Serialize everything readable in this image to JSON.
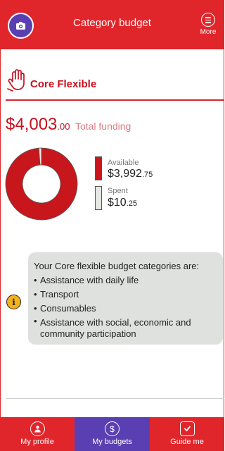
{
  "header": {
    "title": "Category budget",
    "more_label": "More"
  },
  "category": {
    "title": "Core Flexible"
  },
  "funding": {
    "total_major": "$4,003",
    "total_minor": ".00",
    "total_label": "Total funding"
  },
  "chart_data": {
    "type": "pie",
    "title": "",
    "categories": [
      "Available",
      "Spent"
    ],
    "values": [
      3992.75,
      10.25
    ],
    "colors": [
      "#c8161d",
      "#e6e8e6"
    ]
  },
  "legend": {
    "available_label": "Available",
    "available_major": "$3,992",
    "available_minor": ".75",
    "spent_label": "Spent",
    "spent_major": "$10",
    "spent_minor": ".25"
  },
  "info": {
    "intro": "Your Core flexible budget categories are:",
    "items": [
      "Assistance with daily life",
      "Transport",
      "Consumables",
      "Assistance with social, economic and community participation"
    ]
  },
  "nav": {
    "items": [
      {
        "label": "My profile",
        "icon": "person-icon"
      },
      {
        "label": "My budgets",
        "icon": "dollar-icon"
      },
      {
        "label": "Guide me",
        "icon": "checklist-icon"
      }
    ]
  },
  "colors": {
    "brand_red": "#e0262b",
    "brand_purple": "#5a3fb3",
    "accent_red": "#c8101e",
    "info_bg": "#dfe1df"
  }
}
